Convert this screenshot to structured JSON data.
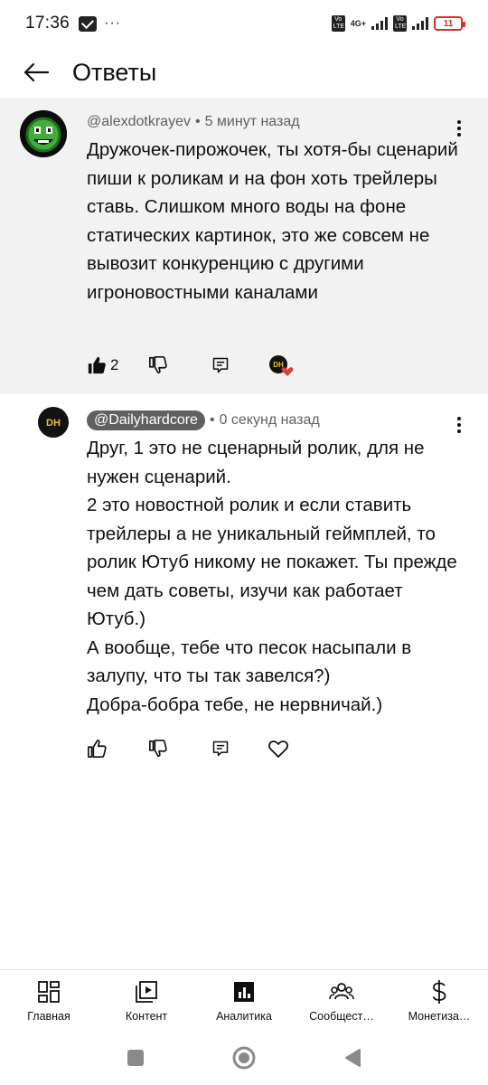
{
  "status_bar": {
    "time": "17:36",
    "more": "···",
    "network": "4G+",
    "volte": "Vo LTE",
    "battery": "11"
  },
  "header": {
    "title": "Ответы"
  },
  "parent_comment": {
    "author": "@alexdotkrayev",
    "time": "5 минут назад",
    "text": "Дружочек-пирожочек, ты хотя-бы сценарий пиши к роликам и на фон хоть трейлеры ставь. Слишком много воды на фоне статических картинок, это же совсем не вывозит конкуренцию с другими игроновостными каналами",
    "likes": "2",
    "creator_badge": "DH"
  },
  "reply_comment": {
    "author": "@Dailyhardcore",
    "time": "0 секунд назад",
    "text": "Друг, 1 это не сценарный ролик, для не нужен сценарий.\n2 это новостной ролик и если ставить трейлеры а не уникальный геймплей, то ролик Ютуб никому не покажет. Ты прежде чем дать советы, изучи как работает Ютуб.)\nА вообще, тебе что песок насыпали в залупу, что ты так завелся?)\nДобра-бобра тебе, не нервничай.)",
    "avatar_label": "DH"
  },
  "bottom_nav": {
    "items": [
      {
        "label": "Главная",
        "icon": "dashboard-icon"
      },
      {
        "label": "Контент",
        "icon": "content-icon"
      },
      {
        "label": "Аналитика",
        "icon": "analytics-icon"
      },
      {
        "label": "Сообщест…",
        "icon": "community-icon"
      },
      {
        "label": "Монетиза…",
        "icon": "dollar-icon"
      }
    ]
  },
  "colors": {
    "parent_bg": "#f2f2f2",
    "chip_bg": "#606060",
    "battery_low": "#d32f2f",
    "heart": "#e53935"
  }
}
